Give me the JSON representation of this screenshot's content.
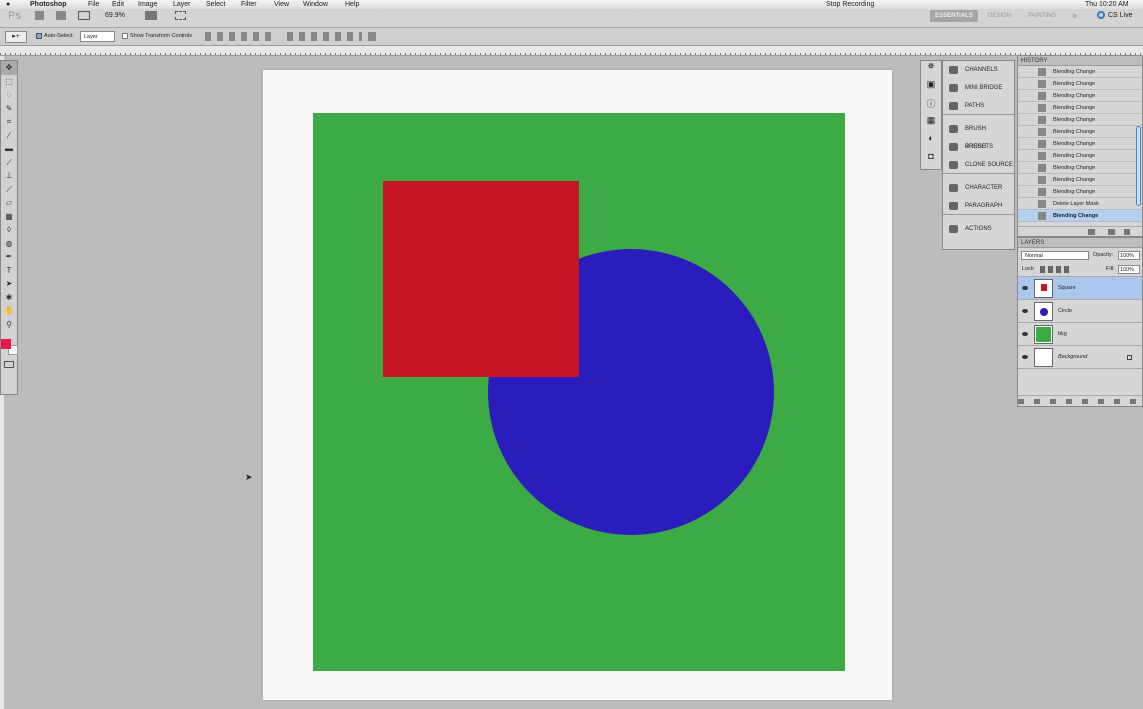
{
  "menubar": {
    "app": "Photoshop",
    "items": [
      "File",
      "Edit",
      "Image",
      "Layer",
      "Select",
      "Filter",
      "View",
      "Window",
      "Help"
    ],
    "recording": "Stop Recording",
    "clock": "Thu 10:20 AM"
  },
  "appbar": {
    "logo": "Ps",
    "zoom": "69.9%",
    "workspaces": [
      "ESSENTIALS",
      "DESIGN",
      "PAINTING"
    ],
    "more": "»",
    "cs_live": "CS Live"
  },
  "options": {
    "auto_select_label": "Auto-Select:",
    "auto_select_checked": true,
    "auto_select_target": "Layer",
    "show_transform_label": "Show Transform Controls"
  },
  "dock": {
    "groups": [
      [
        "CHANNELS",
        "MINI BRIDGE",
        "PATHS"
      ],
      [
        "BRUSH PRESETS",
        "BRUSH",
        "CLONE SOURCE"
      ],
      [
        "CHARACTER",
        "PARAGRAPH"
      ],
      [
        "ACTIONS"
      ]
    ]
  },
  "history": {
    "title": "HISTORY",
    "items": [
      "Blending Change",
      "Blending Change",
      "Blending Change",
      "Blending Change",
      "Blending Change",
      "Blending Change",
      "Blending Change",
      "Blending Change",
      "Blending Change",
      "Blending Change",
      "Blending Change",
      "Delete Layer Mask",
      "Blending Change"
    ],
    "selected_index": 12
  },
  "layers": {
    "title": "LAYERS",
    "blend_mode": "Normal",
    "opacity_label": "Opacity:",
    "opacity": "100%",
    "lock_label": "Lock:",
    "fill_label": "Fill:",
    "fill": "100%",
    "items": [
      {
        "name": "Square",
        "selected": true,
        "color": "#c51523"
      },
      {
        "name": "Circle",
        "selected": false,
        "color": "#2b1cbc"
      },
      {
        "name": "bkg",
        "selected": false,
        "color": "#3dab45"
      },
      {
        "name": "Background",
        "selected": false,
        "color": "#ffffff",
        "locked": true
      }
    ]
  },
  "colors": {
    "foreground": "#e8174a",
    "background": "#ffffff"
  }
}
